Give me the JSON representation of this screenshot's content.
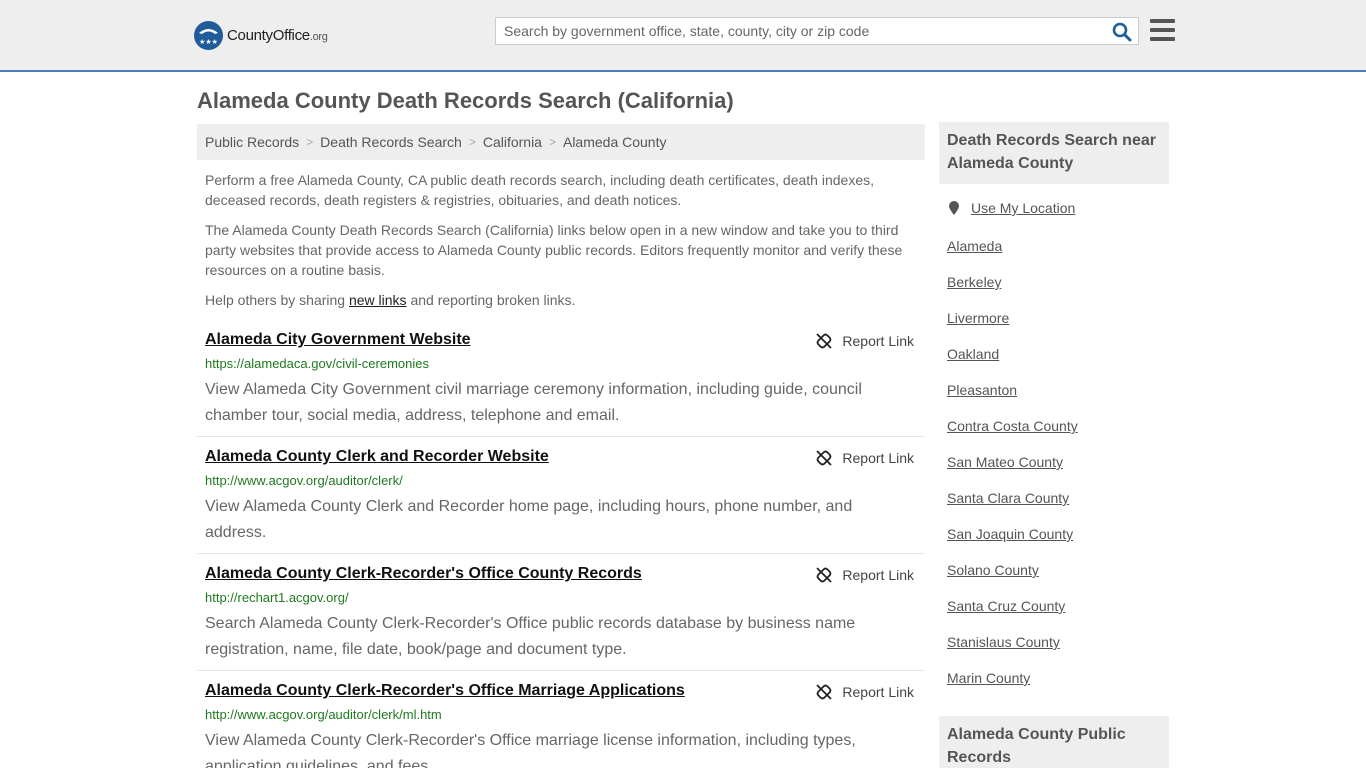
{
  "header": {
    "logo_main": "CountyOffice",
    "logo_org": ".org",
    "search_placeholder": "Search by government office, state, county, city or zip code"
  },
  "page": {
    "title": "Alameda County Death Records Search (California)"
  },
  "breadcrumb": [
    "Public Records",
    "Death Records Search",
    "California",
    "Alameda County"
  ],
  "intro": {
    "p1": "Perform a free Alameda County, CA public death records search, including death certificates, death indexes, deceased records, death registers & registries, obituaries, and death notices.",
    "p2": "The Alameda County Death Records Search (California) links below open in a new window and take you to third party websites that provide access to Alameda County public records. Editors frequently monitor and verify these resources on a routine basis.",
    "p3_before": "Help others by sharing ",
    "p3_link": "new links",
    "p3_after": " and reporting broken links."
  },
  "results": [
    {
      "title": "Alameda City Government Website",
      "url": "https://alamedaca.gov/civil-ceremonies",
      "desc": "View Alameda City Government civil marriage ceremony information, including guide, council chamber tour, social media, address, telephone and email.",
      "report": "Report Link"
    },
    {
      "title": "Alameda County Clerk and Recorder Website",
      "url": "http://www.acgov.org/auditor/clerk/",
      "desc": "View Alameda County Clerk and Recorder home page, including hours, phone number, and address.",
      "report": "Report Link"
    },
    {
      "title": "Alameda County Clerk-Recorder's Office County Records",
      "url": "http://rechart1.acgov.org/",
      "desc": "Search Alameda County Clerk-Recorder's Office public records database by business name registration, name, file date, book/page and document type.",
      "report": "Report Link"
    },
    {
      "title": "Alameda County Clerk-Recorder's Office Marriage Applications",
      "url": "http://www.acgov.org/auditor/clerk/ml.htm",
      "desc": "View Alameda County Clerk-Recorder's Office marriage license information, including types, application guidelines, and fees.",
      "report": "Report Link"
    }
  ],
  "sidebar": {
    "nearby_title": "Death Records Search near Alameda County",
    "use_location": "Use My Location",
    "links": [
      "Alameda",
      "Berkeley",
      "Livermore",
      "Oakland",
      "Pleasanton",
      "Contra Costa County",
      "San Mateo County",
      "Santa Clara County",
      "San Joaquin County",
      "Solano County",
      "Santa Cruz County",
      "Stanislaus County",
      "Marin County"
    ],
    "public_records_title": "Alameda County Public Records"
  },
  "colors": {
    "accent": "#4a7fb5",
    "url_green": "#1f7a1f",
    "panel_bg": "#eeeeee"
  }
}
